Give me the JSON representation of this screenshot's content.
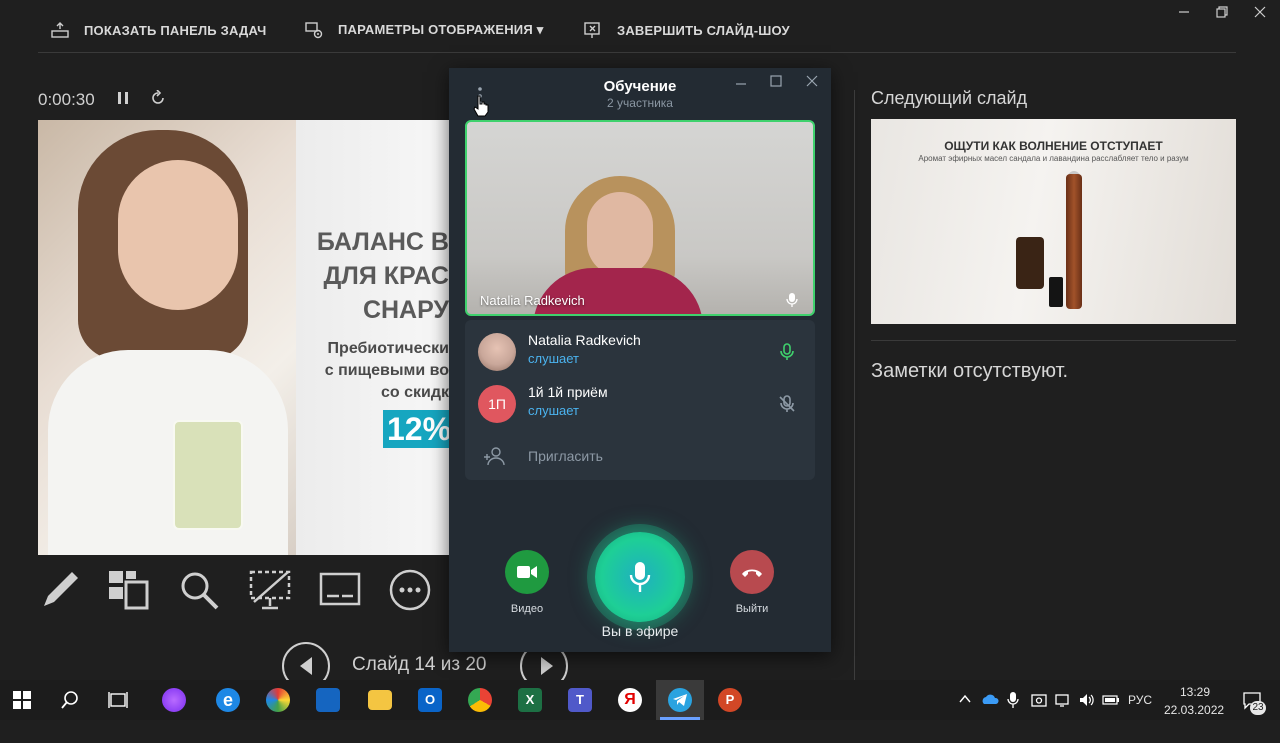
{
  "toolbar": {
    "show_taskbar": "ПОКАЗАТЬ ПАНЕЛЬ ЗАДАЧ",
    "display_settings": "ПАРАМЕТРЫ ОТОБРАЖЕНИЯ ▾",
    "end_slideshow": "ЗАВЕРШИТЬ СЛАЙД-ШОУ"
  },
  "presenter": {
    "timer": "0:00:30",
    "slide_counter": "Слайд 14 из 20",
    "current_slide": {
      "line1": "БАЛАНС В",
      "line2": "ДЛЯ КРАС",
      "line3": "СНАРУ",
      "sub1": "Пребиотически",
      "sub2": "с пищевыми во",
      "sub3": "со скидк",
      "discount": "12%"
    },
    "tools": [
      "pen-icon",
      "slides-grid-icon",
      "zoom-icon",
      "black-screen-icon",
      "subtitles-icon",
      "more-icon"
    ]
  },
  "next_slide": {
    "label": "Следующий слайд",
    "heading": "ОЩУТИ КАК ВОЛНЕНИЕ ОТСТУПАЕТ",
    "subheading": "Аромат эфирных масел сандала и лавандина расслабляет тело и разум"
  },
  "notes": {
    "text": "Заметки отсутствуют."
  },
  "call": {
    "title": "Обучение",
    "subtitle": "2 участника",
    "video_name": "Natalia Radkevich",
    "participants": [
      {
        "name": "Natalia Radkevich",
        "status": "слушает",
        "avatar": "",
        "mic": "on",
        "avatar_color": "#c9a79a"
      },
      {
        "name": "1й 1й приём",
        "status": "слушает",
        "avatar": "1П",
        "mic": "off",
        "avatar_color": "#e0575f"
      }
    ],
    "invite": "Пригласить",
    "video_label": "Видео",
    "leave_label": "Выйти",
    "on_air": "Вы в эфире",
    "colors": {
      "accent": "#1ecf96",
      "video_btn": "#1f9a40",
      "leave_btn": "#b84a4f",
      "status": "#4bb3ef"
    }
  },
  "taskbar": {
    "language": "РУС",
    "time": "13:29",
    "date": "22.03.2022",
    "notifications": "23",
    "apps": [
      "windows-icon",
      "search-icon",
      "task-view-icon",
      "alice-icon",
      "edge-icon",
      "paint-icon",
      "photos-icon",
      "explorer-icon",
      "outlook-icon",
      "chrome-icon",
      "excel-icon",
      "teams-icon",
      "yandex-icon",
      "telegram-icon",
      "powerpoint-icon"
    ]
  }
}
